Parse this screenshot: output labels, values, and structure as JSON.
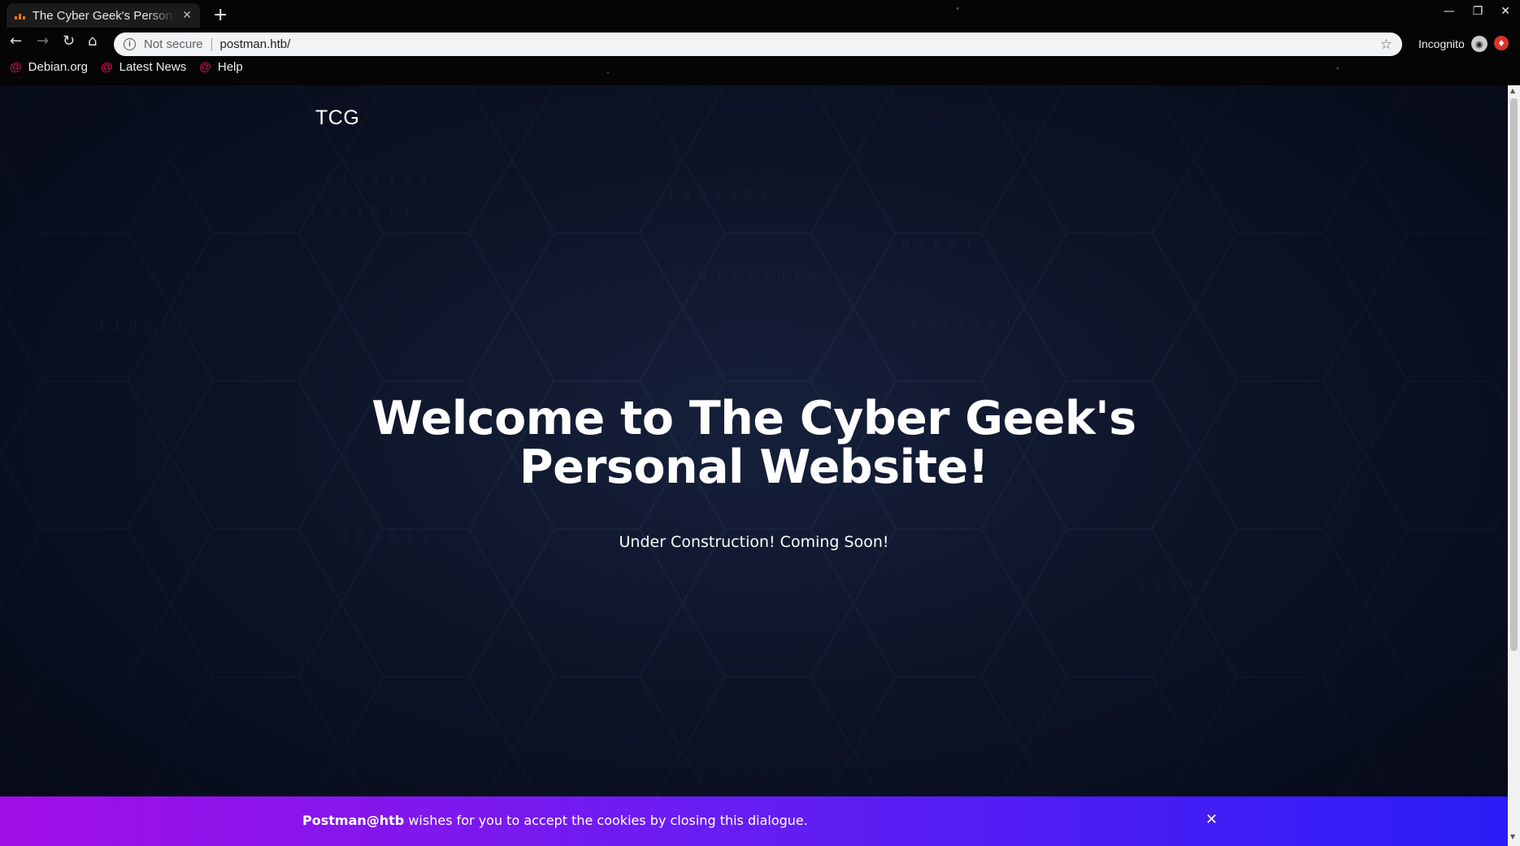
{
  "browser": {
    "tab_title": "The Cyber Geek's Personal Website",
    "address": {
      "security_label": "Not secure",
      "url": "postman.htb/"
    },
    "profile_label": "Incognito",
    "bookmarks": [
      {
        "label": "Debian.org",
        "icon": "debian-swirl-icon"
      },
      {
        "label": "Latest News",
        "icon": "debian-swirl-icon"
      },
      {
        "label": "Help",
        "icon": "debian-swirl-icon"
      }
    ]
  },
  "page": {
    "logo": "TCG",
    "hero_title_line1": "Welcome to The Cyber Geek's",
    "hero_title_line2": "Personal Website!",
    "hero_subtitle": "Under Construction! Coming Soon!",
    "cookie": {
      "brand": "Postman@htb",
      "message": " wishes for you to accept the cookies by closing this dialogue.",
      "close_icon": "close-icon"
    }
  },
  "colors": {
    "background": "#0b1124",
    "cookie_gradient_start": "#a20ee6",
    "cookie_gradient_end": "#2a1df7",
    "omnibox": "#f1f3f4"
  }
}
